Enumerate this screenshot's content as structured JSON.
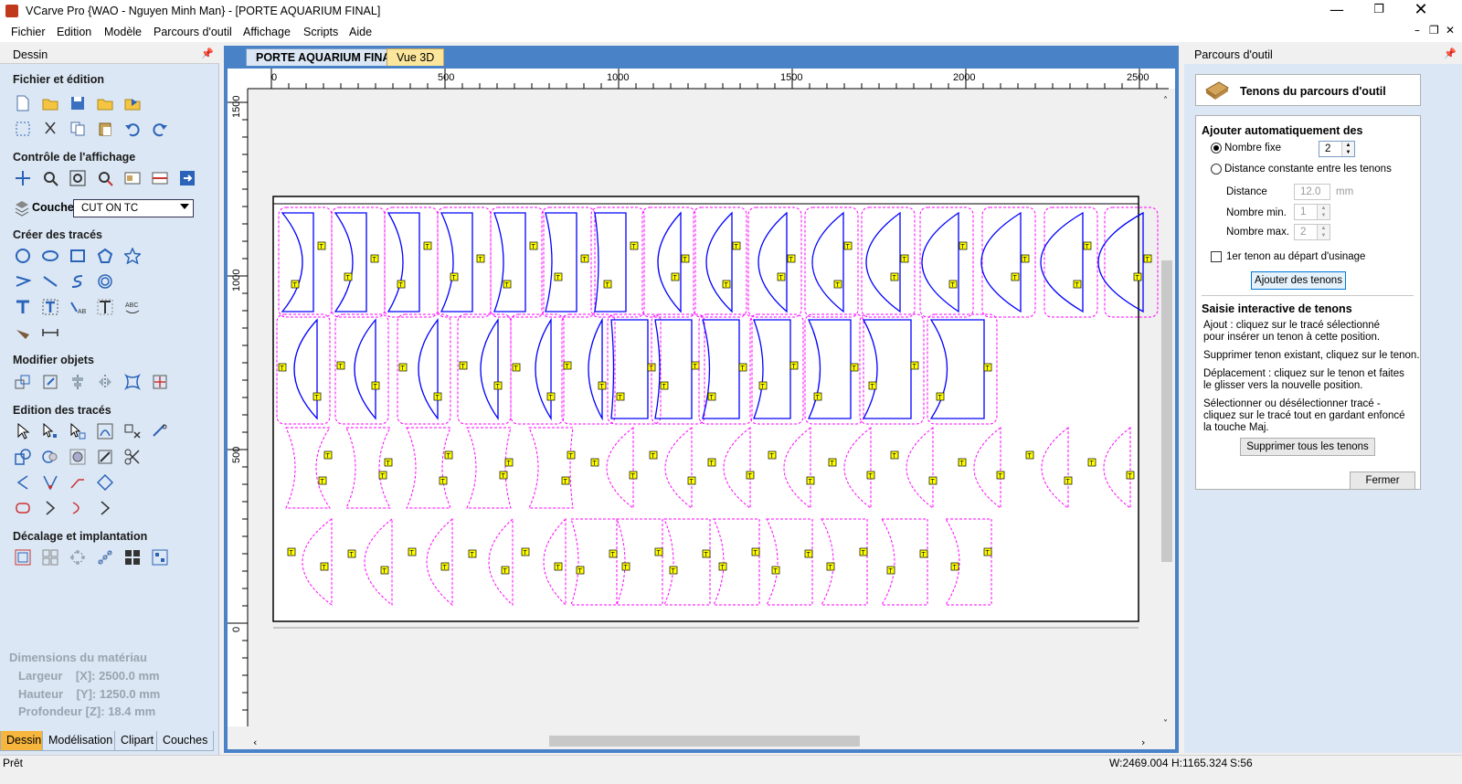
{
  "window": {
    "title": "VCarve Pro {WAO - Nguyen Minh Man} - [PORTE AQUARIUM FINAL]"
  },
  "menu": [
    "Fichier",
    "Edition",
    "Modèle",
    "Parcours d'outil",
    "Affichage",
    "Scripts",
    "Aide"
  ],
  "left_panel": {
    "title": "Dessin",
    "sections": {
      "file": "Fichier et édition",
      "view": "Contrôle de l'affichage",
      "create": "Créer des tracés",
      "modify": "Modifier objets",
      "edit": "Edition des tracés",
      "offset": "Décalage et implantation"
    },
    "layer_label": "Couche",
    "layer_value": "CUT ON TC",
    "material": {
      "title": "Dimensions du matériau",
      "width": "Largeur    [X]: 2500.0 mm",
      "height": "Hauteur    [Y]: 1250.0 mm",
      "depth": "Profondeur [Z]: 18.4 mm"
    },
    "tabs": [
      "Dessin",
      "Modélisation",
      "Clipart",
      "Couches"
    ]
  },
  "doc_tabs": [
    "PORTE AQUARIUM FINAL",
    "Vue 3D"
  ],
  "ruler": {
    "h": [
      "0",
      "500",
      "1000",
      "1500",
      "2000",
      "2500"
    ],
    "v": [
      "1500",
      "1000",
      "500",
      "0"
    ]
  },
  "right_panel": {
    "title": "Parcours d'outil",
    "header": "Tenons du parcours d'outil",
    "auto_title": "Ajouter automatiquement des",
    "fixed_count_label": "Nombre fixe",
    "fixed_count_value": "2",
    "const_distance_label": "Distance constante entre les tenons",
    "distance_label": "Distance",
    "distance_value": "12.0",
    "distance_unit": "mm",
    "min_label": "Nombre min.",
    "min_value": "1",
    "max_label": "Nombre max.",
    "max_value": "2",
    "first_tab_label": "1er tenon au départ d'usinage",
    "add_button": "Ajouter des tenons",
    "interactive_title": "Saisie interactive de tenons",
    "help1": "Ajout : cliquez sur le tracé sélectionné",
    "help1b": "pour insérer un tenon à cette position.",
    "help2": "Supprimer tenon existant, cliquez sur le tenon.",
    "help3": "Déplacement : cliquez sur le tenon et faites",
    "help3b": "le glisser vers la nouvelle position.",
    "help4": "Sélectionner ou désélectionner tracé -",
    "help4b": "cliquez sur le tracé tout en gardant enfoncé",
    "help4c": "la touche Maj.",
    "delete_all": "Supprimer tous les tenons",
    "close": "Fermer"
  },
  "status": {
    "left": "Prêt",
    "w": "W:2469.004",
    "h": "H:1165.324",
    "s": "S:56"
  },
  "colors": {
    "accent": "#4a82c8",
    "panel": "#dbe7f4",
    "vector": "#0000ff",
    "toolpath": "#ff00ff",
    "tab": "#ffff00",
    "active_tab": "#f6b53c"
  }
}
